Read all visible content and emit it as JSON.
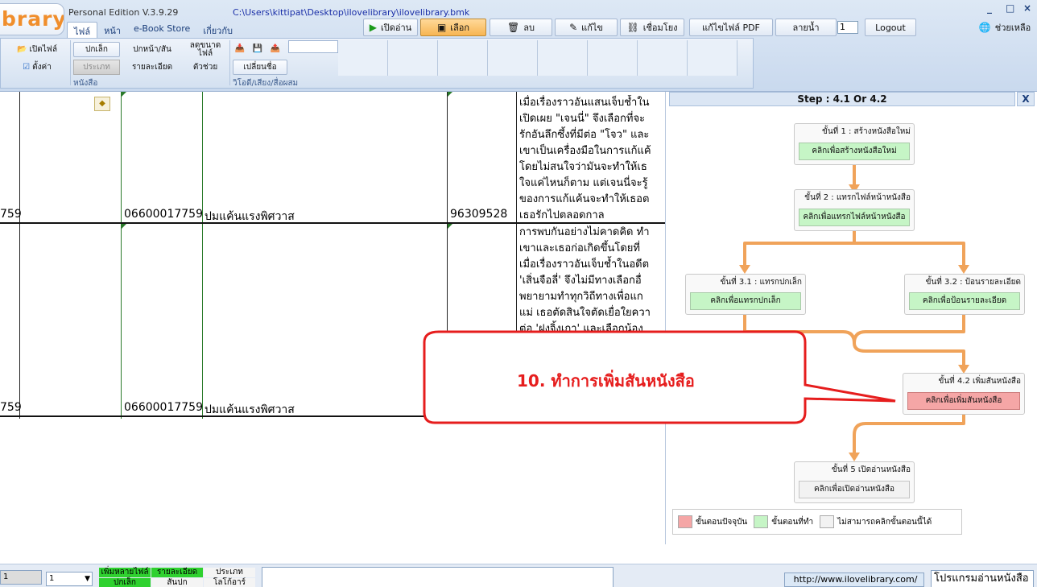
{
  "app": {
    "logo_text": "brary",
    "edition": "Personal Edition V.3.9.29",
    "file_path": "C:\\Users\\kittipat\\Desktop\\ilovelibrary\\ilovelibrary.bmk",
    "window_controls": [
      "_",
      "□",
      "×"
    ]
  },
  "menu_tabs": [
    {
      "label": "ไฟล์",
      "active": true
    },
    {
      "label": "หน้า",
      "active": false
    },
    {
      "label": "e-Book Store",
      "active": false
    },
    {
      "label": "เกี่ยวกับ",
      "active": false
    }
  ],
  "toolbar": {
    "open_read": "เปิดอ่าน",
    "select": "เลือก",
    "delete": "ลบ",
    "edit": "แก้ไข",
    "link": "เชื่อมโยง",
    "edit_pdf": "แก้ไขไฟล์ PDF",
    "watermark": "ลายน้ำ",
    "page_value": "1",
    "logout": "Logout",
    "help": "ช่วยเหลือ"
  },
  "ribbon": {
    "open_file": "เปิดไฟล์",
    "settings": "ตั้งค่า",
    "small_cover": "ปกเล็ก",
    "cover_spine": "ปกหน้า/สัน",
    "reduce_file": "ลดขนาดไฟล์",
    "category": "ประเภท",
    "details": "รายละเอียด",
    "helper": "ตัวช่วย",
    "rename": "เปลี่ยนชื่อ",
    "group_book": "หนังสือ",
    "group_media": "วิโอดี/เสียง/สื่อผสม"
  },
  "table": {
    "rows": [
      {
        "col0": "759",
        "code": "06600017759",
        "title": "ปมแค้นแรงพิศวาส",
        "isbn": "96309528",
        "desc_lines": [
          "เมื่อเรื่องราวอันแสนเจ็บช้ำใน",
          "เปิดเผย \"เจนนี่\" จึงเลือกที่จะ",
          "รักอันลึกซึ้งที่มีต่อ \"โจว\" และ",
          "เขาเป็นเครื่องมือในการแก้แค้",
          "โดยไม่สนใจว่ามันจะทำให้เธ",
          "ใจแค่ไหนก็ตาม แต่เจนนี่จะรู้",
          "ของการแก้แค้นจะทำให้เธอต",
          "เธอรักไปตลอดกาล"
        ]
      },
      {
        "col0": "759",
        "code": "06600017759",
        "title": "ปมแค้นแรงพิศวาส",
        "desc_lines": [
          "การพบกันอย่างไม่คาดคิด ทำ",
          "เขาและเธอก่อเกิดขึ้นโดยที่",
          "เมื่อเรื่องราวอันเจ็บช้ำในอดีต",
          "'เสิ่นจือลี่' จึงไม่มีทางเลือกอื่",
          "พยายามทำทุกวิถีทางเพื่อแก",
          "แม่ เธอตัดสินใจตัดเยื่อใยควา",
          "ต่อ 'ฝงจิ้งเกา' และเลือกน้อง"
        ]
      }
    ]
  },
  "wizard": {
    "header": "Step : 4.1 Or 4.2",
    "close": "X",
    "steps": [
      {
        "title": "ขั้นที่ 1 : สร้างหนังสือใหม่",
        "button": "คลิกเพื่อสร้างหนังสือใหม่",
        "state": "done"
      },
      {
        "title": "ขั้นที่ 2 : แทรกไฟล์หน้าหนังสือ",
        "button": "คลิกเพื่อแทรกไฟล์หน้าหนังสือ",
        "state": "done"
      },
      {
        "title": "ขั้นที่ 3.1 : แทรกปกเล็ก",
        "button": "คลิกเพื่อแทรกปกเล็ก",
        "state": "done"
      },
      {
        "title": "ขั้นที่ 3.2 : ป้อนรายละเอียด",
        "button": "คลิกเพื่อป้อนรายละเอียด",
        "state": "done"
      },
      {
        "title": "ขั้นที่ 4.2 เพิ่มสันหนังสือ",
        "button": "คลิกเพื่อเพิ่มสันหนังสือ",
        "state": "current"
      },
      {
        "title": "ขั้นที่ 5 เปิดอ่านหนังสือ",
        "button": "คลิกเพื่อเปิดอ่านหนังสือ",
        "state": "disabled"
      }
    ],
    "legend": {
      "current": "ขั้นตอนปัจจุบัน",
      "done": "ขั้นตอนที่ทำ",
      "disabled": "ไม่สามารถคลิกขั้นตอนนี้ได้"
    }
  },
  "callout": {
    "text": "10. ทำการเพิ่มสันหนังสือ"
  },
  "status": {
    "field1": "1",
    "combo": "1",
    "tag_add_many": "เพิ่มหลายไฟล์",
    "tag_details": "รายละเอียด",
    "tag_category": "ประเภท",
    "tag_small_cover": "ปกเล็ก",
    "tag_spine": "สันปก",
    "tag_logo": "โลโก้อาร์",
    "url": "http://www.ilovelibrary.com/",
    "reader": "โปรแกรมอ่านหนังสือ"
  },
  "colors": {
    "current_step": "#f5a6a6",
    "done_step": "#c6f5c6",
    "flow_arrow": "#f0a35a",
    "callout": "#e61d1d"
  }
}
